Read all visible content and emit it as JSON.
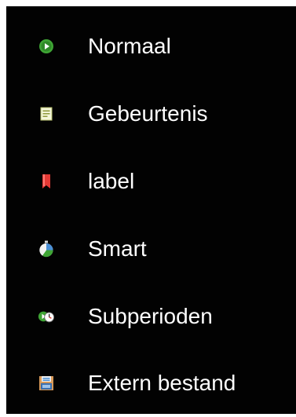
{
  "menu": {
    "items": [
      {
        "label": "Normaal",
        "icon": "play-circle-icon",
        "color": "#3fa535"
      },
      {
        "label": "Gebeurtenis",
        "icon": "note-icon",
        "color": "#e6edb0"
      },
      {
        "label": "label",
        "icon": "bookmark-icon",
        "color": "#e53935"
      },
      {
        "label": "Smart",
        "icon": "smart-icon",
        "color": "#4a8fd6"
      },
      {
        "label": "Subperioden",
        "icon": "clock-icon",
        "color": "#3fa535"
      },
      {
        "label": "Extern bestand",
        "icon": "floppy-icon",
        "color": "#d89a5a"
      }
    ]
  }
}
